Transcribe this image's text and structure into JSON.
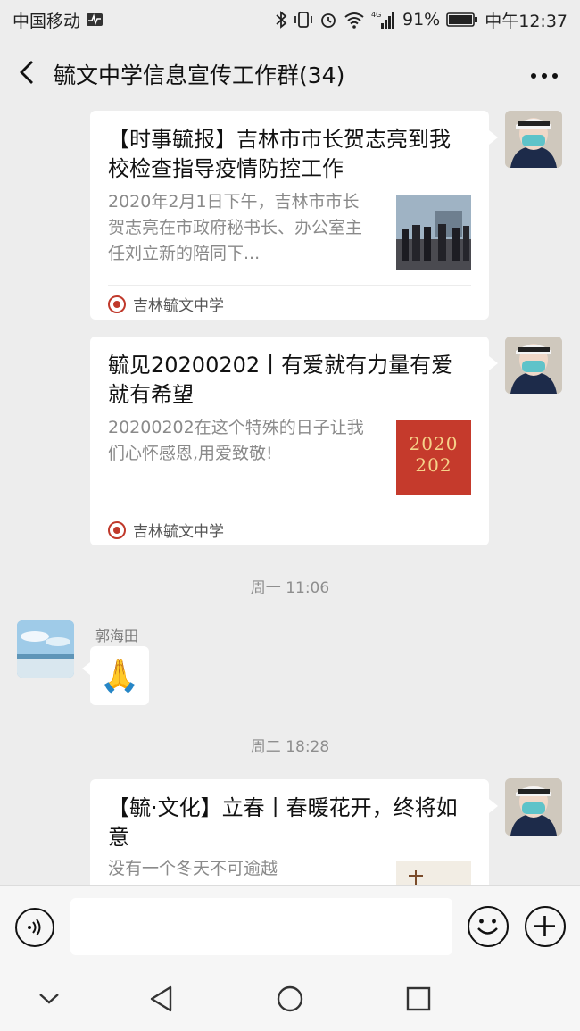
{
  "status_bar": {
    "carrier": "中国移动",
    "network": "4G",
    "battery": "91%",
    "time": "中午12:37"
  },
  "header": {
    "title": "毓文中学信息宣传工作群(34)"
  },
  "messages": [
    {
      "type": "article",
      "title": "【时事毓报】吉林市市长贺志亮到我校检查指导疫情防控工作",
      "description": "2020年2月1日下午，吉林市市长贺志亮在市政府秘书长、办公室主任刘立新的陪同下...",
      "source": "吉林毓文中学"
    },
    {
      "type": "article",
      "title": "毓见20200202丨有爱就有力量有爱就有希望",
      "description": "20200202在这个特殊的日子让我们心怀感恩,用爱致敬!",
      "source": "吉林毓文中学",
      "thumb_text": [
        "2020",
        "202"
      ]
    },
    {
      "type": "time",
      "text": "周一 11:06"
    },
    {
      "type": "emoji",
      "sender": "郭海田",
      "emoji": "🙏"
    },
    {
      "type": "time",
      "text": "周二 18:28"
    },
    {
      "type": "article",
      "title": "【毓·文化】立春丨春暖花开，终将如意",
      "description": "没有一个冬天不可逾越"
    }
  ],
  "input": {
    "placeholder": ""
  },
  "colors": {
    "background": "#ededed",
    "bubble": "#ffffff",
    "accent_red": "#c0392b"
  }
}
